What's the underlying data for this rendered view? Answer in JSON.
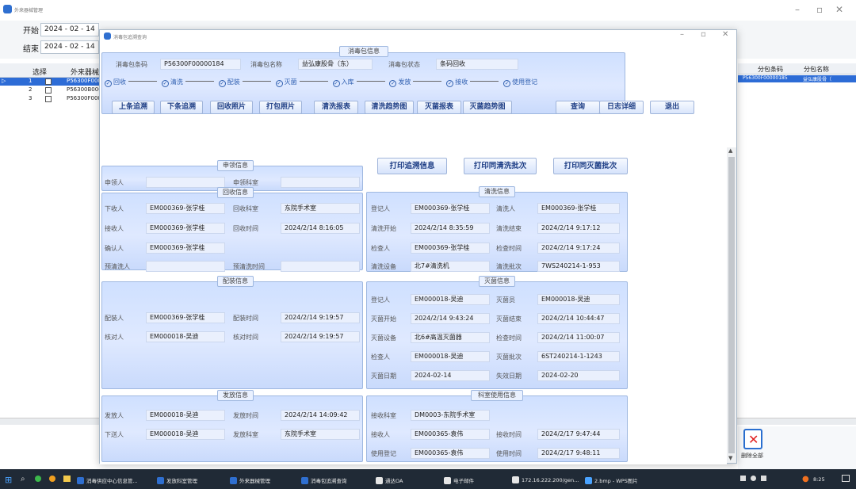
{
  "main_window": {
    "title": "外来器械管理",
    "filter": {
      "start_label": "开始",
      "start_value": "2024 - 02 - 14",
      "end_label": "结束",
      "end_value": "2024 - 02 - 14"
    },
    "grid": {
      "headers": {
        "select": "选择",
        "ext_barcode": "外来器械",
        "sub_barcode": "分包条码",
        "sub_name": "分包名称"
      },
      "rows": [
        {
          "no": "1",
          "code": "P56300F000"
        },
        {
          "no": "2",
          "code": "P56300B000"
        },
        {
          "no": "3",
          "code": "P56300F000"
        }
      ],
      "right_row": {
        "sub_barcode": "P56300F00000185",
        "sub_name": "益弘康股骨（"
      }
    },
    "delete_badge": "删除全部"
  },
  "dialog": {
    "title": "消毒包追溯查询",
    "info": {
      "title": "消毒包信息",
      "barcode_label": "消毒包条码",
      "barcode_value": "P56300F00000184",
      "name_label": "消毒包名称",
      "name_value": "益弘康股骨（东）",
      "status_label": "消毒包状态",
      "status_value": "条码回收"
    },
    "steps": [
      "回收",
      "清洗",
      "配装",
      "灭菌",
      "入库",
      "发放",
      "接收",
      "使用登记"
    ],
    "toolbar": {
      "prev": "上条追溯",
      "next": "下条追溯",
      "recycle_photo": "回收照片",
      "pack_photo": "打包照片",
      "wash_report": "清洗报表",
      "wash_trend": "清洗趋势图",
      "steril_report": "灭菌报表",
      "steril_trend": "灭菌趋势图",
      "query": "查询",
      "log": "日志详细",
      "exit": "退出"
    },
    "print": {
      "trace": "打印追溯信息",
      "wash_batch": "打印同清洗批次",
      "steril_batch": "打印同灭菌批次"
    },
    "apply": {
      "title": "申领信息",
      "applicant": "申领人",
      "dept": "申领科室"
    },
    "recycle": {
      "title": "回收信息",
      "l1": "下收人",
      "v1": "EM000369-张学桂",
      "l2": "回收科室",
      "v2": "东院手术室",
      "l3": "接收人",
      "v3": "EM000369-张学桂",
      "l4": "回收时间",
      "v4": "2024/2/14 8:16:05",
      "l5": "确认人",
      "v5": "EM000369-张学桂",
      "l6": "预清洗人",
      "l7": "预清洗时间"
    },
    "wash": {
      "title": "清洗信息",
      "l1": "登记人",
      "v1": "EM000369-张学桂",
      "l2": "清洗人",
      "v2": "EM000369-张学桂",
      "l3": "清洗开始",
      "v3": "2024/2/14 8:35:59",
      "l4": "清洗结束",
      "v4": "2024/2/14 9:17:12",
      "l5": "检查人",
      "v5": "EM000369-张学桂",
      "l6": "检查时间",
      "v6": "2024/2/14 9:17:24",
      "l7": "清洗设备",
      "v7": "北7#清洗机",
      "l8": "清洗批次",
      "v8": "7WS240214-1-953"
    },
    "pack": {
      "title": "配装信息",
      "l1": "配装人",
      "v1": "EM000369-张学桂",
      "l2": "配装时间",
      "v2": "2024/2/14 9:19:57",
      "l3": "核对人",
      "v3": "EM000018-吴迪",
      "l4": "核对时间",
      "v4": "2024/2/14 9:19:57"
    },
    "steril": {
      "title": "灭菌信息",
      "l1": "登记人",
      "v1": "EM000018-吴迪",
      "l2": "灭菌员",
      "v2": "EM000018-吴迪",
      "l3": "灭菌开始",
      "v3": "2024/2/14 9:43:24",
      "l4": "灭菌结束",
      "v4": "2024/2/14 10:44:47",
      "l5": "灭菌设备",
      "v5": "北6#高温灭菌器",
      "l6": "检查时间",
      "v6": "2024/2/14 11:00:07",
      "l7": "检查人",
      "v7": "EM000018-吴迪",
      "l8": "灭菌批次",
      "v8": "6ST240214-1-1243",
      "l9": "灭菌日期",
      "v9": "2024-02-14",
      "l10": "失效日期",
      "v10": "2024-02-20"
    },
    "issue": {
      "title": "发放信息",
      "l1": "发放人",
      "v1": "EM000018-吴迪",
      "l2": "发放时间",
      "v2": "2024/2/14 14:09:42",
      "l3": "下送人",
      "v3": "EM000018-吴迪",
      "l4": "发放科室",
      "v4": "东院手术室"
    },
    "usage": {
      "title": "科室使用信息",
      "l1": "接收科室",
      "v1": "DM0003-东院手术室",
      "l2": "接收人",
      "v2": "EM000365-袁伟",
      "l3": "接收时间",
      "v3": "2024/2/17 9:47:44",
      "l4": "使用登记",
      "v4": "EM000365-袁伟",
      "l5": "使用时间",
      "v5": "2024/2/17 9:48:11"
    }
  },
  "taskbar": {
    "items": [
      "消毒供应中心信息管...",
      "发放科室管理",
      "外来器械管理",
      "消毒包追溯查询",
      "通达OA",
      "电子邮件",
      "172.16.222.200/gen...",
      "2.bmp - WPS图片"
    ],
    "time": "8:25"
  }
}
